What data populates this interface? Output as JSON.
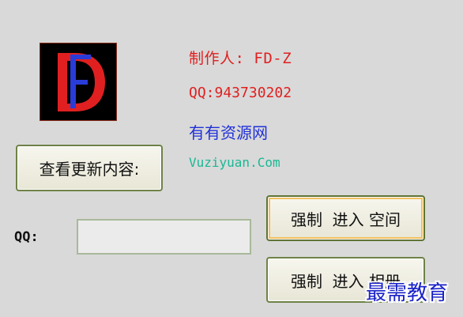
{
  "logo": {
    "letter_text": "FD",
    "colors": {
      "background": "#000000",
      "letter_d": "#e02020",
      "letter_f": "#2a3cd8"
    }
  },
  "info": {
    "author": "制作人: FD-Z",
    "qq": "QQ:943730202",
    "site_name": "有有资源网",
    "site_url": "Vuziyuan.Com"
  },
  "buttons": {
    "changelog": "查看更新内容:",
    "force_enter_space": "强制  进入 空间",
    "force_enter_album": "强制  进入 相册"
  },
  "qq_field": {
    "label": "QQ:",
    "value": ""
  },
  "watermark": "最需教育",
  "colors": {
    "background": "#d9d9d9",
    "accent_red": "#e02020",
    "accent_blue": "#2030d8",
    "accent_teal": "#19b894",
    "button_border": "#6e8246"
  }
}
